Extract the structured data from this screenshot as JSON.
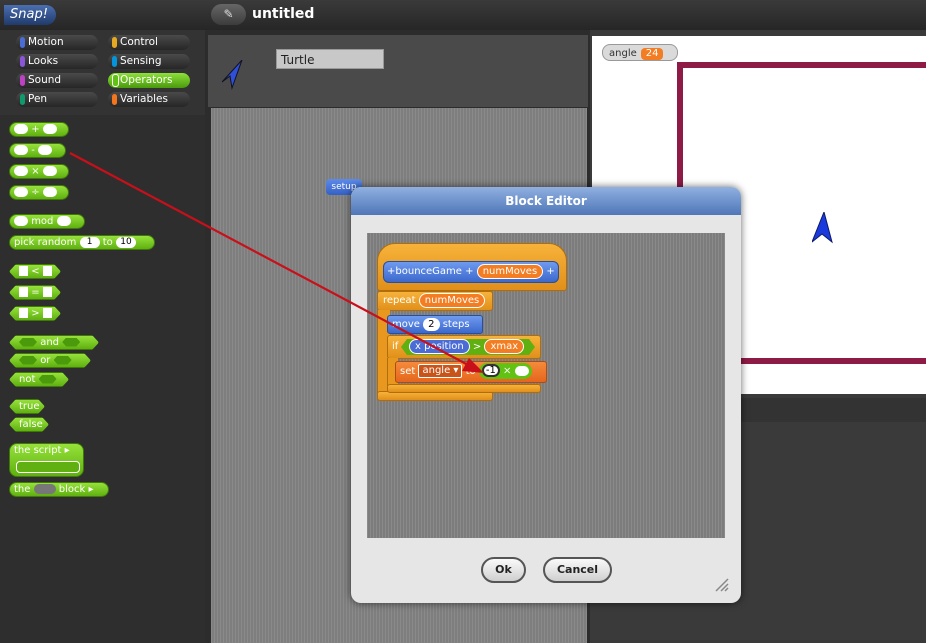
{
  "app": {
    "logo": "Snap!",
    "edit_icon": "✎",
    "project_title": "untitled"
  },
  "categories": [
    {
      "label": "Motion",
      "color": "#4a6cd4"
    },
    {
      "label": "Looks",
      "color": "#8a55d7"
    },
    {
      "label": "Sound",
      "color": "#bb42c3"
    },
    {
      "label": "Pen",
      "color": "#0e9a6c"
    },
    {
      "label": "Control",
      "color": "#e6a822"
    },
    {
      "label": "Sensing",
      "color": "#0494dc"
    },
    {
      "label": "Operators",
      "color": "#62c213"
    },
    {
      "label": "Variables",
      "color": "#f3761d"
    }
  ],
  "palette": {
    "plus": "+",
    "minus": "-",
    "times": "×",
    "divide": "÷",
    "mod": "mod",
    "pick_random": "pick random",
    "pick_to": "to",
    "pick_from_val": "1",
    "pick_to_val": "10",
    "lt": "<",
    "eq": "=",
    "gt": ">",
    "and": "and",
    "or": "or",
    "not": "not",
    "true": "true",
    "false": "false",
    "the_script": "the script",
    "the_block_pre": "the",
    "the_block_post": "block"
  },
  "sprite": {
    "name": "Turtle"
  },
  "scripts": {
    "setup_label": "setup"
  },
  "stage": {
    "watcher_label": "angle",
    "watcher_value": "24"
  },
  "block_editor": {
    "title": "Block Editor",
    "hat_plus_left": "+",
    "block_name": "bounceGame",
    "hat_plus_mid": "+",
    "param": "numMoves",
    "hat_plus_right": "+",
    "repeat_label": "repeat",
    "repeat_var": "numMoves",
    "move_label": "move",
    "move_val": "2",
    "move_suffix": "steps",
    "if_label": "if",
    "xpos_label": "x position",
    "gt_sign": ">",
    "xmax_var": "xmax",
    "set_label": "set",
    "set_var": "angle",
    "set_to": "to",
    "times_left": "-1",
    "times_sign": "×",
    "ok_label": "Ok",
    "cancel_label": "Cancel"
  }
}
